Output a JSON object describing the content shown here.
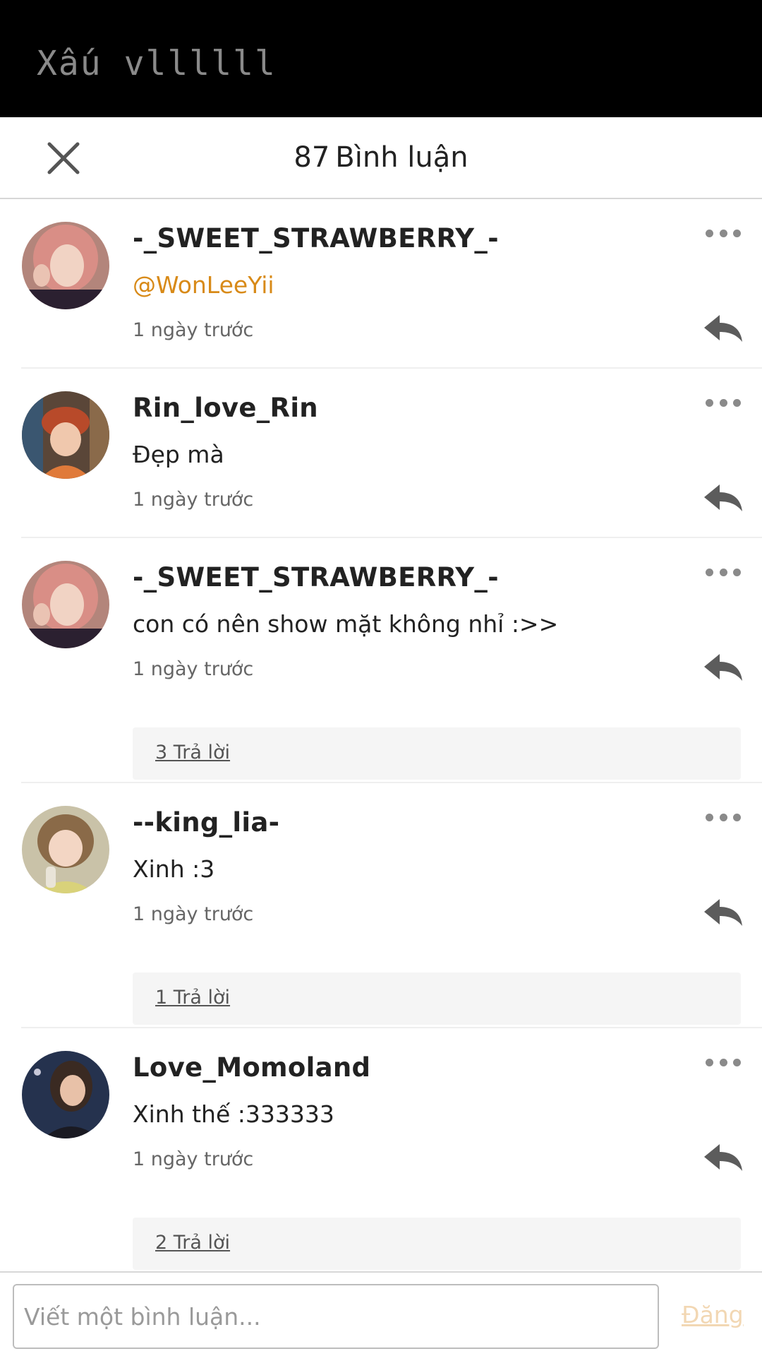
{
  "banner": {
    "text": "Xấu vllllll"
  },
  "header": {
    "count": "87",
    "title": "Bình luận"
  },
  "comments": [
    {
      "username": "-_SWEET_STRAWBERRY_-",
      "text": "@WonLeeYii",
      "time": "1 ngày trước"
    },
    {
      "username": "Rin_love_Rin",
      "text": "Đẹp mà",
      "time": "1 ngày trước"
    },
    {
      "username": "-_SWEET_STRAWBERRY_-",
      "text": "con có nên show mặt không nhỉ :>>",
      "time": "1 ngày trước",
      "replies": "3 Trả lời"
    },
    {
      "username": "--king_lia-",
      "text": "Xinh :3",
      "time": "1 ngày trước",
      "replies": "1 Trả lời"
    },
    {
      "username": "Love_Momoland",
      "text": "Xinh thế :333333",
      "time": "1 ngày trước",
      "replies": "2 Trả lời"
    }
  ],
  "footer": {
    "placeholder": "Viết một bình luận...",
    "post_label": "Đăng"
  },
  "colors": {
    "mention": "#d88a18",
    "banner_bg": "#000000",
    "post_disabled": "#f2d7b3"
  },
  "icons": {
    "close": "close-icon",
    "more": "more-dots-icon",
    "reply": "reply-arrow-icon"
  }
}
